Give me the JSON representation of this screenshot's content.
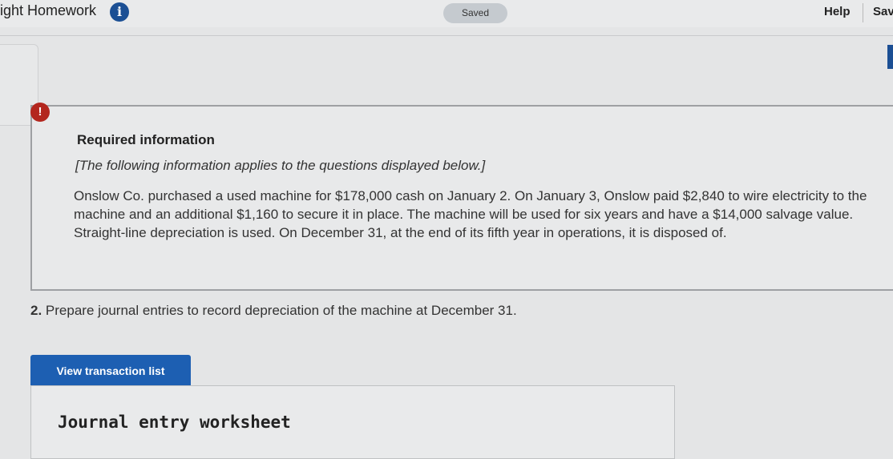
{
  "header": {
    "app_title": "ight Homework",
    "info_icon": "i",
    "status": "Saved",
    "help_label": "Help",
    "save_label": "Sav"
  },
  "alert_icon": "!",
  "required_info": {
    "heading": "Required information",
    "note": "[The following information applies to the questions displayed below.]",
    "body": "Onslow Co. purchased a used machine for $178,000 cash on January 2. On January 3, Onslow paid $2,840 to wire electricity to the machine and an additional $1,160 to secure it in place. The machine will be used for six years and have a $14,000 salvage value. Straight-line depreciation is used. On December 31, at the end of its fifth year in operations, it is disposed of."
  },
  "question": {
    "number": "2.",
    "text": "Prepare journal entries to record depreciation of the machine at December 31."
  },
  "view_transaction_button": "View transaction list",
  "worksheet_title": "Journal entry worksheet",
  "colors": {
    "brand_blue": "#1d5fb2",
    "info_blue": "#1b4f94",
    "alert_red": "#b3261e"
  },
  "icons": {
    "info": "info-icon",
    "alert": "alert-icon"
  }
}
